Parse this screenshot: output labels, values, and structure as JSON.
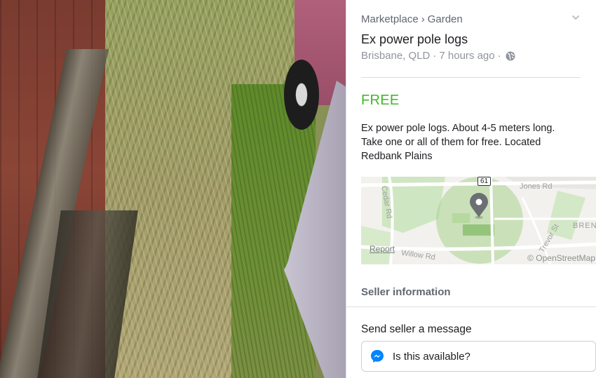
{
  "listing": {
    "breadcrumb": {
      "category": "Marketplace",
      "separator": "›",
      "subcategory": "Garden"
    },
    "title": "Ex power pole logs",
    "location": "Brisbane, QLD",
    "dot": "·",
    "posted": "7 hours ago",
    "price": "FREE",
    "description": "Ex power pole logs. About 4-5 meters long. Take one or all of them for free. Located Redbank Plains",
    "icons": {
      "globe": "globe-icon",
      "expand": "chevron-down-icon",
      "map_pin": "map-pin-icon",
      "messenger": "messenger-icon"
    },
    "colors": {
      "price": "#42b72a",
      "muted": "#90949c",
      "messenger": "#0084ff"
    }
  },
  "map": {
    "road_number": "61",
    "streets": {
      "cedar": "Cedar Rd",
      "jones": "Jones Rd",
      "willow": "Willow Rd",
      "trevor": "Trevor St",
      "brent": "BRENT"
    },
    "report_link": "Report",
    "attribution": "© OpenStreetMap"
  },
  "seller": {
    "header": "Seller information"
  },
  "message": {
    "label": "Send seller a message",
    "value": "Is this available?"
  }
}
